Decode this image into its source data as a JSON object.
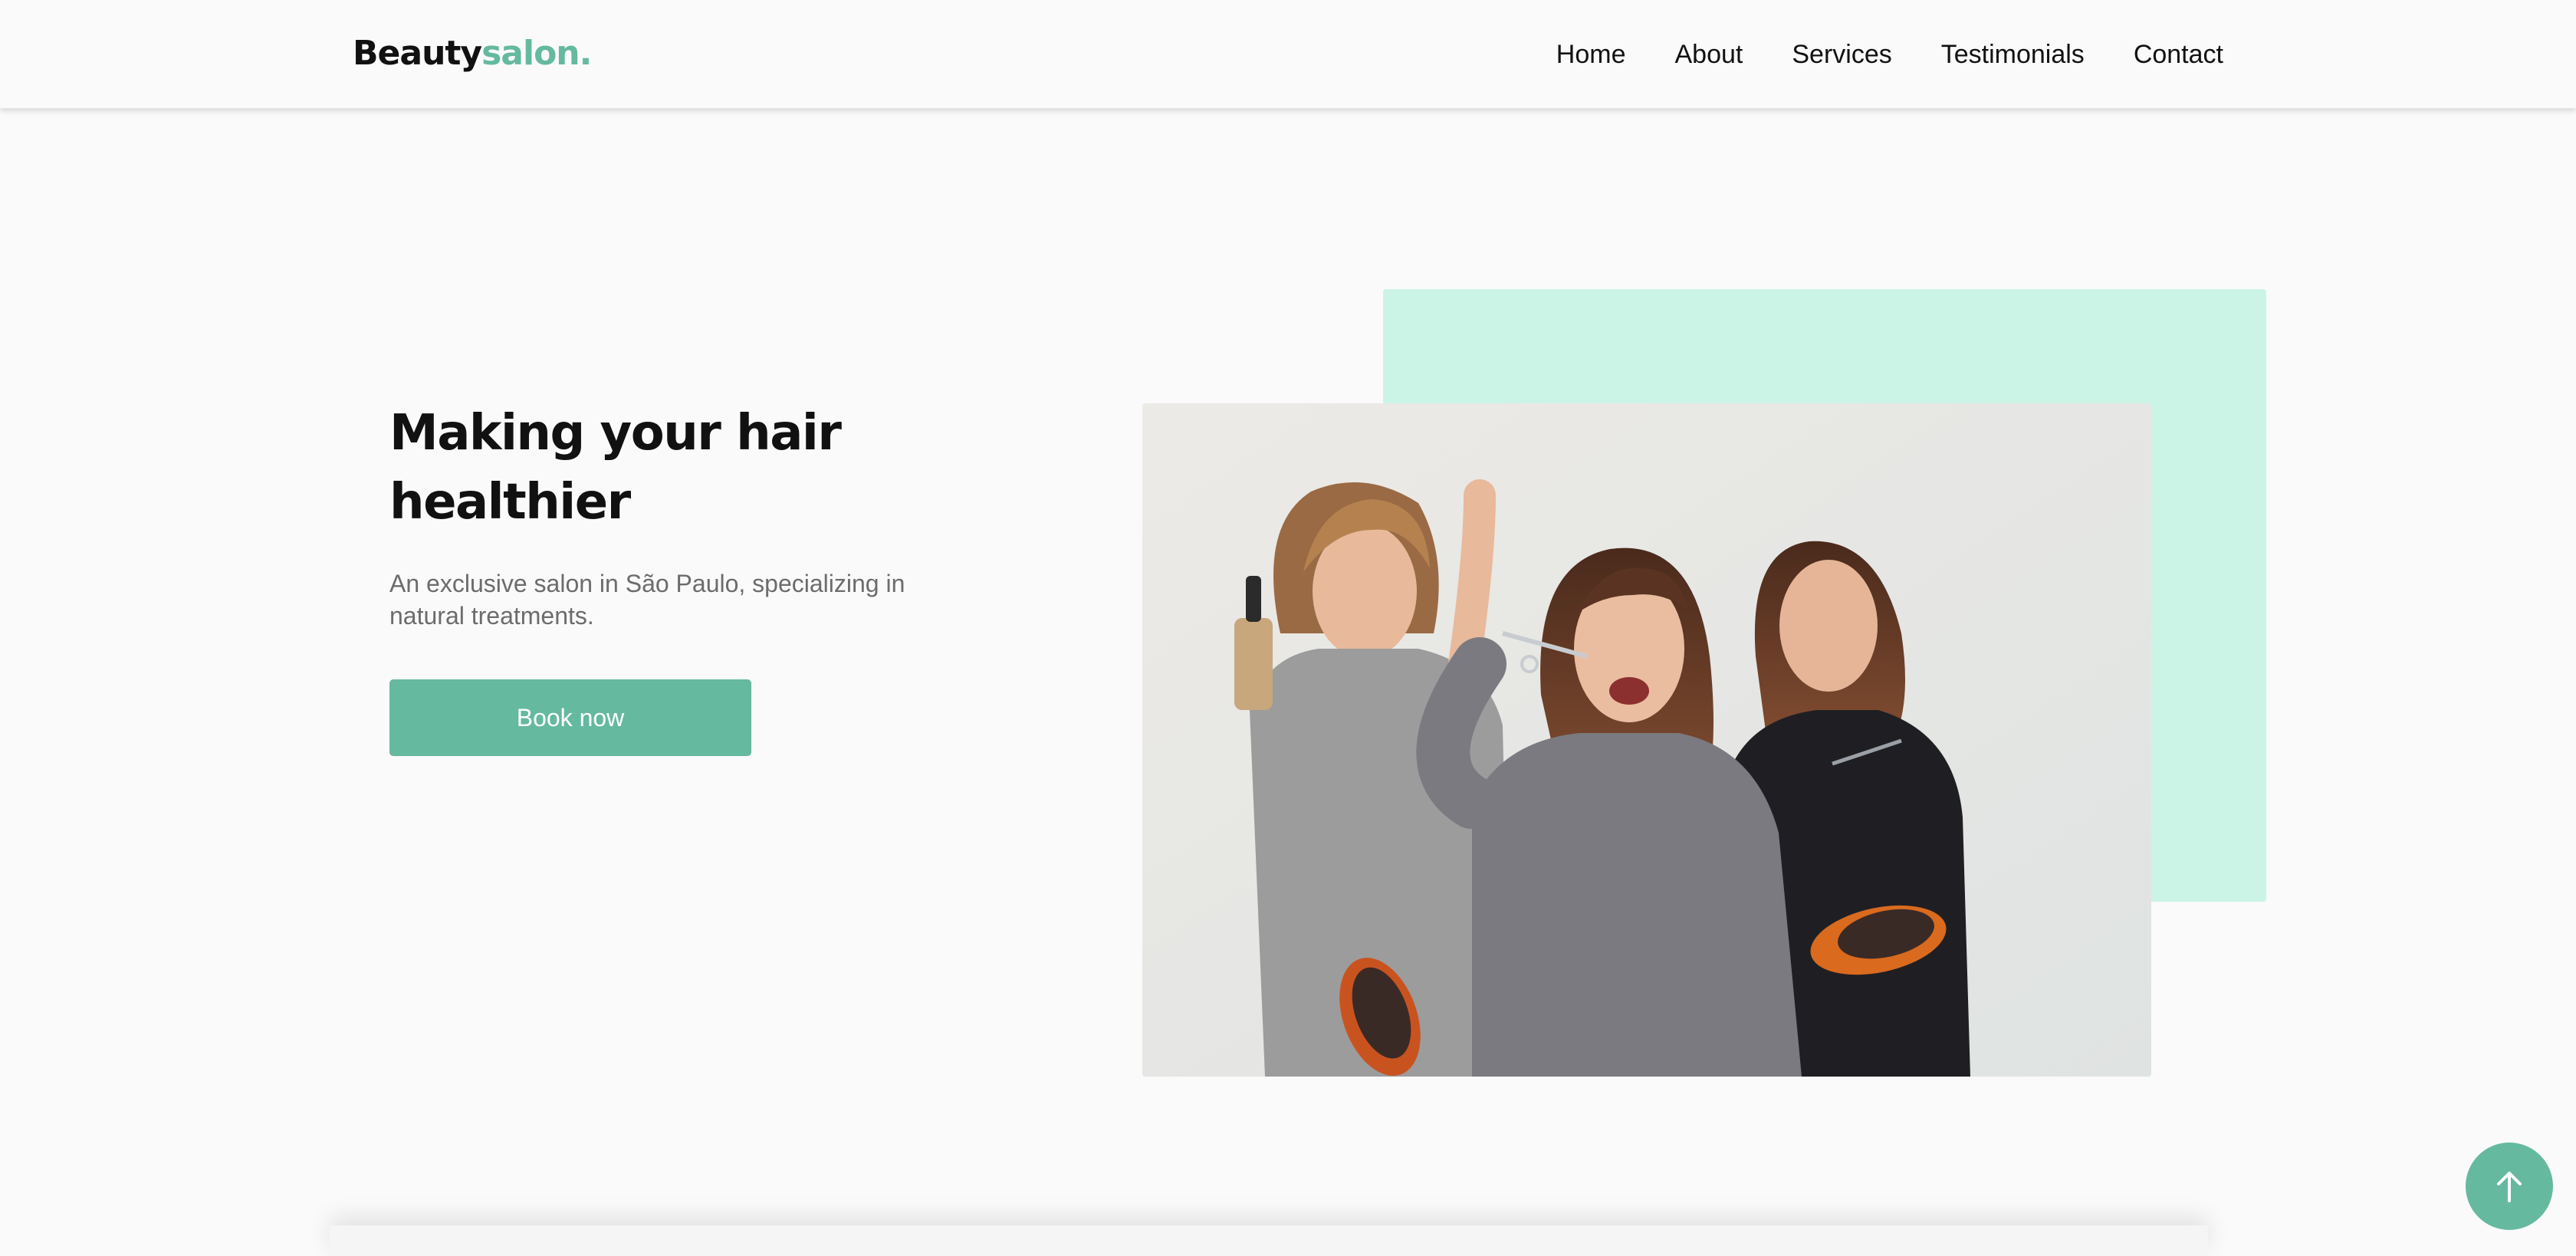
{
  "header": {
    "logo": {
      "main": "Beauty",
      "accent": "salon."
    },
    "nav": [
      {
        "label": "Home"
      },
      {
        "label": "About"
      },
      {
        "label": "Services"
      },
      {
        "label": "Testimonials"
      },
      {
        "label": "Contact"
      }
    ]
  },
  "hero": {
    "title": "Making your hair healthier",
    "subtitle": "An exclusive salon in São Paulo, specializing in natural treatments.",
    "button_label": "Book now"
  },
  "colors": {
    "accent": "#65b99f",
    "mint_block": "#ccf4e6",
    "background": "#fafafa",
    "text_dark": "#111111",
    "text_muted": "#6c6c6c"
  },
  "icons": {
    "back_to_top": "arrow-up-icon"
  }
}
